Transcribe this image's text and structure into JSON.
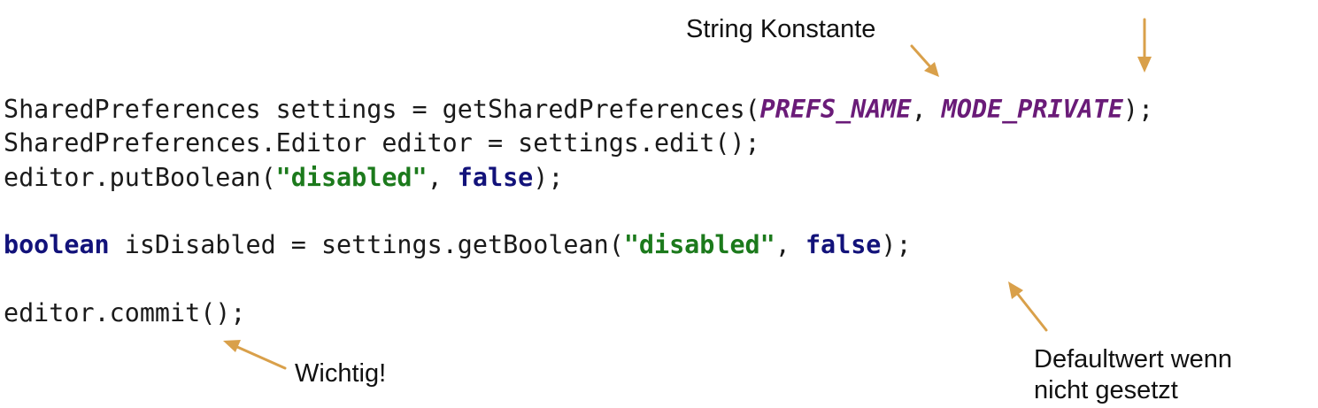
{
  "code": {
    "line1": {
      "prefix": "SharedPreferences settings = getSharedPreferences(",
      "const1": "PREFS_NAME",
      "sep": ", ",
      "const2": "MODE_PRIVATE",
      "suffix": ");"
    },
    "line2": {
      "text": "SharedPreferences.Editor editor = settings.edit();"
    },
    "line3": {
      "prefix": "editor.putBoolean(",
      "string": "\"disabled\"",
      "sep": ", ",
      "keyword": "false",
      "suffix": ");"
    },
    "line4": {
      "keyword": "boolean",
      "middle": " isDisabled = settings.getBoolean(",
      "string": "\"disabled\"",
      "sep": ", ",
      "keyword2": "false",
      "suffix": ");"
    },
    "line5": {
      "text": "editor.commit();"
    }
  },
  "annotations": {
    "string_constant": "String Konstante",
    "important": "Wichtig!",
    "default_line1": "Defaultwert wenn",
    "default_line2": "nicht gesetzt"
  },
  "colors": {
    "constant": "#6a1b78",
    "string": "#1c7a1c",
    "keyword": "#12127a",
    "arrow": "#d9a04a"
  }
}
